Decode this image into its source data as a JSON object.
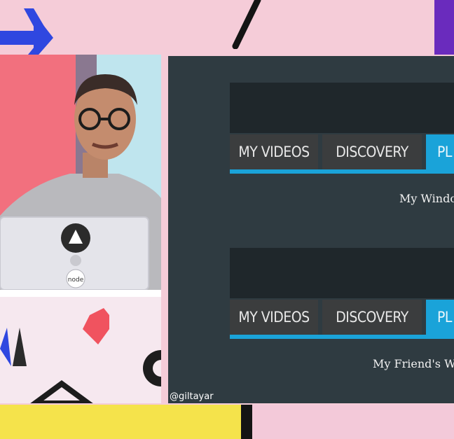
{
  "slide": {
    "blocks": [
      {
        "tabs": [
          "MY VIDEOS",
          "DISCOVERY",
          "PL"
        ],
        "active_tab": "PL",
        "caption": "My Windo"
      },
      {
        "tabs": [
          "MY VIDEOS",
          "DISCOVERY",
          "PL"
        ],
        "active_tab": "PL",
        "caption": "My Friend's Wir"
      }
    ],
    "handle": "@giltayar"
  },
  "speaker": {
    "laptop_sticker_text": "node"
  },
  "colors": {
    "background": "#f5ccd8",
    "slide_bg": "#2f3b41",
    "tab_header": "#1f272b",
    "tab_dark": "#3b3d3e",
    "tab_active": "#1aa3d9",
    "yellow": "#f5e34b",
    "purple": "#6a2bbd",
    "blue_arrow": "#2f47e0"
  }
}
